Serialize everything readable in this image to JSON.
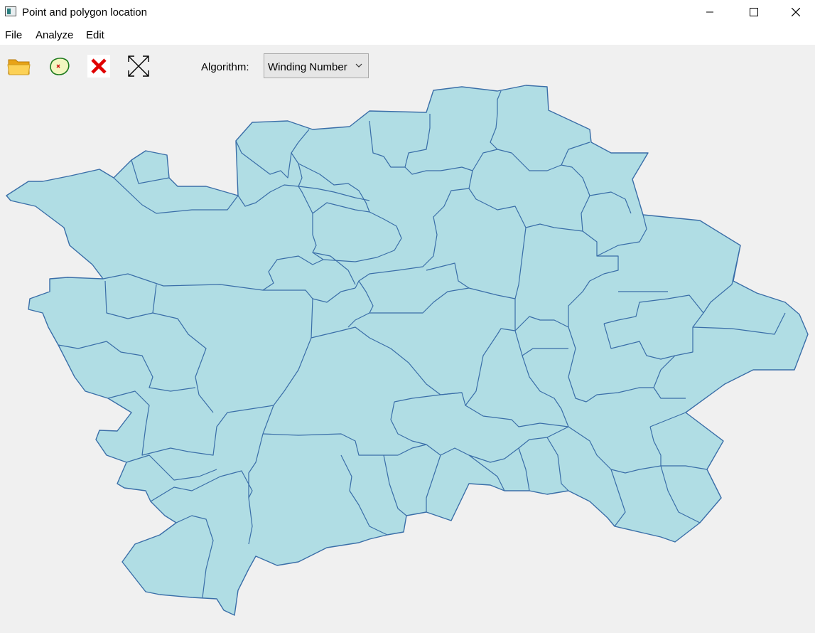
{
  "window": {
    "title": "Point and polygon location",
    "icon": "app-window-icon",
    "controls": [
      "minimize-icon",
      "maximize-icon",
      "close-icon"
    ]
  },
  "menu": {
    "items": [
      {
        "label": "File"
      },
      {
        "label": "Analyze"
      },
      {
        "label": "Edit"
      }
    ]
  },
  "toolbar": {
    "buttons": [
      {
        "icon": "open-folder-icon",
        "action": "Open"
      },
      {
        "icon": "point-in-polygon-icon",
        "action": "Analyze"
      },
      {
        "icon": "clear-icon",
        "action": "Clear"
      },
      {
        "icon": "fit-extent-icon",
        "action": "Resize"
      }
    ],
    "algorithm_label": "Algorithm:",
    "algorithm_value": "Winding Number"
  },
  "map": {
    "fill_color": "#b0dde4",
    "stroke_color": "#3a6ea8"
  }
}
